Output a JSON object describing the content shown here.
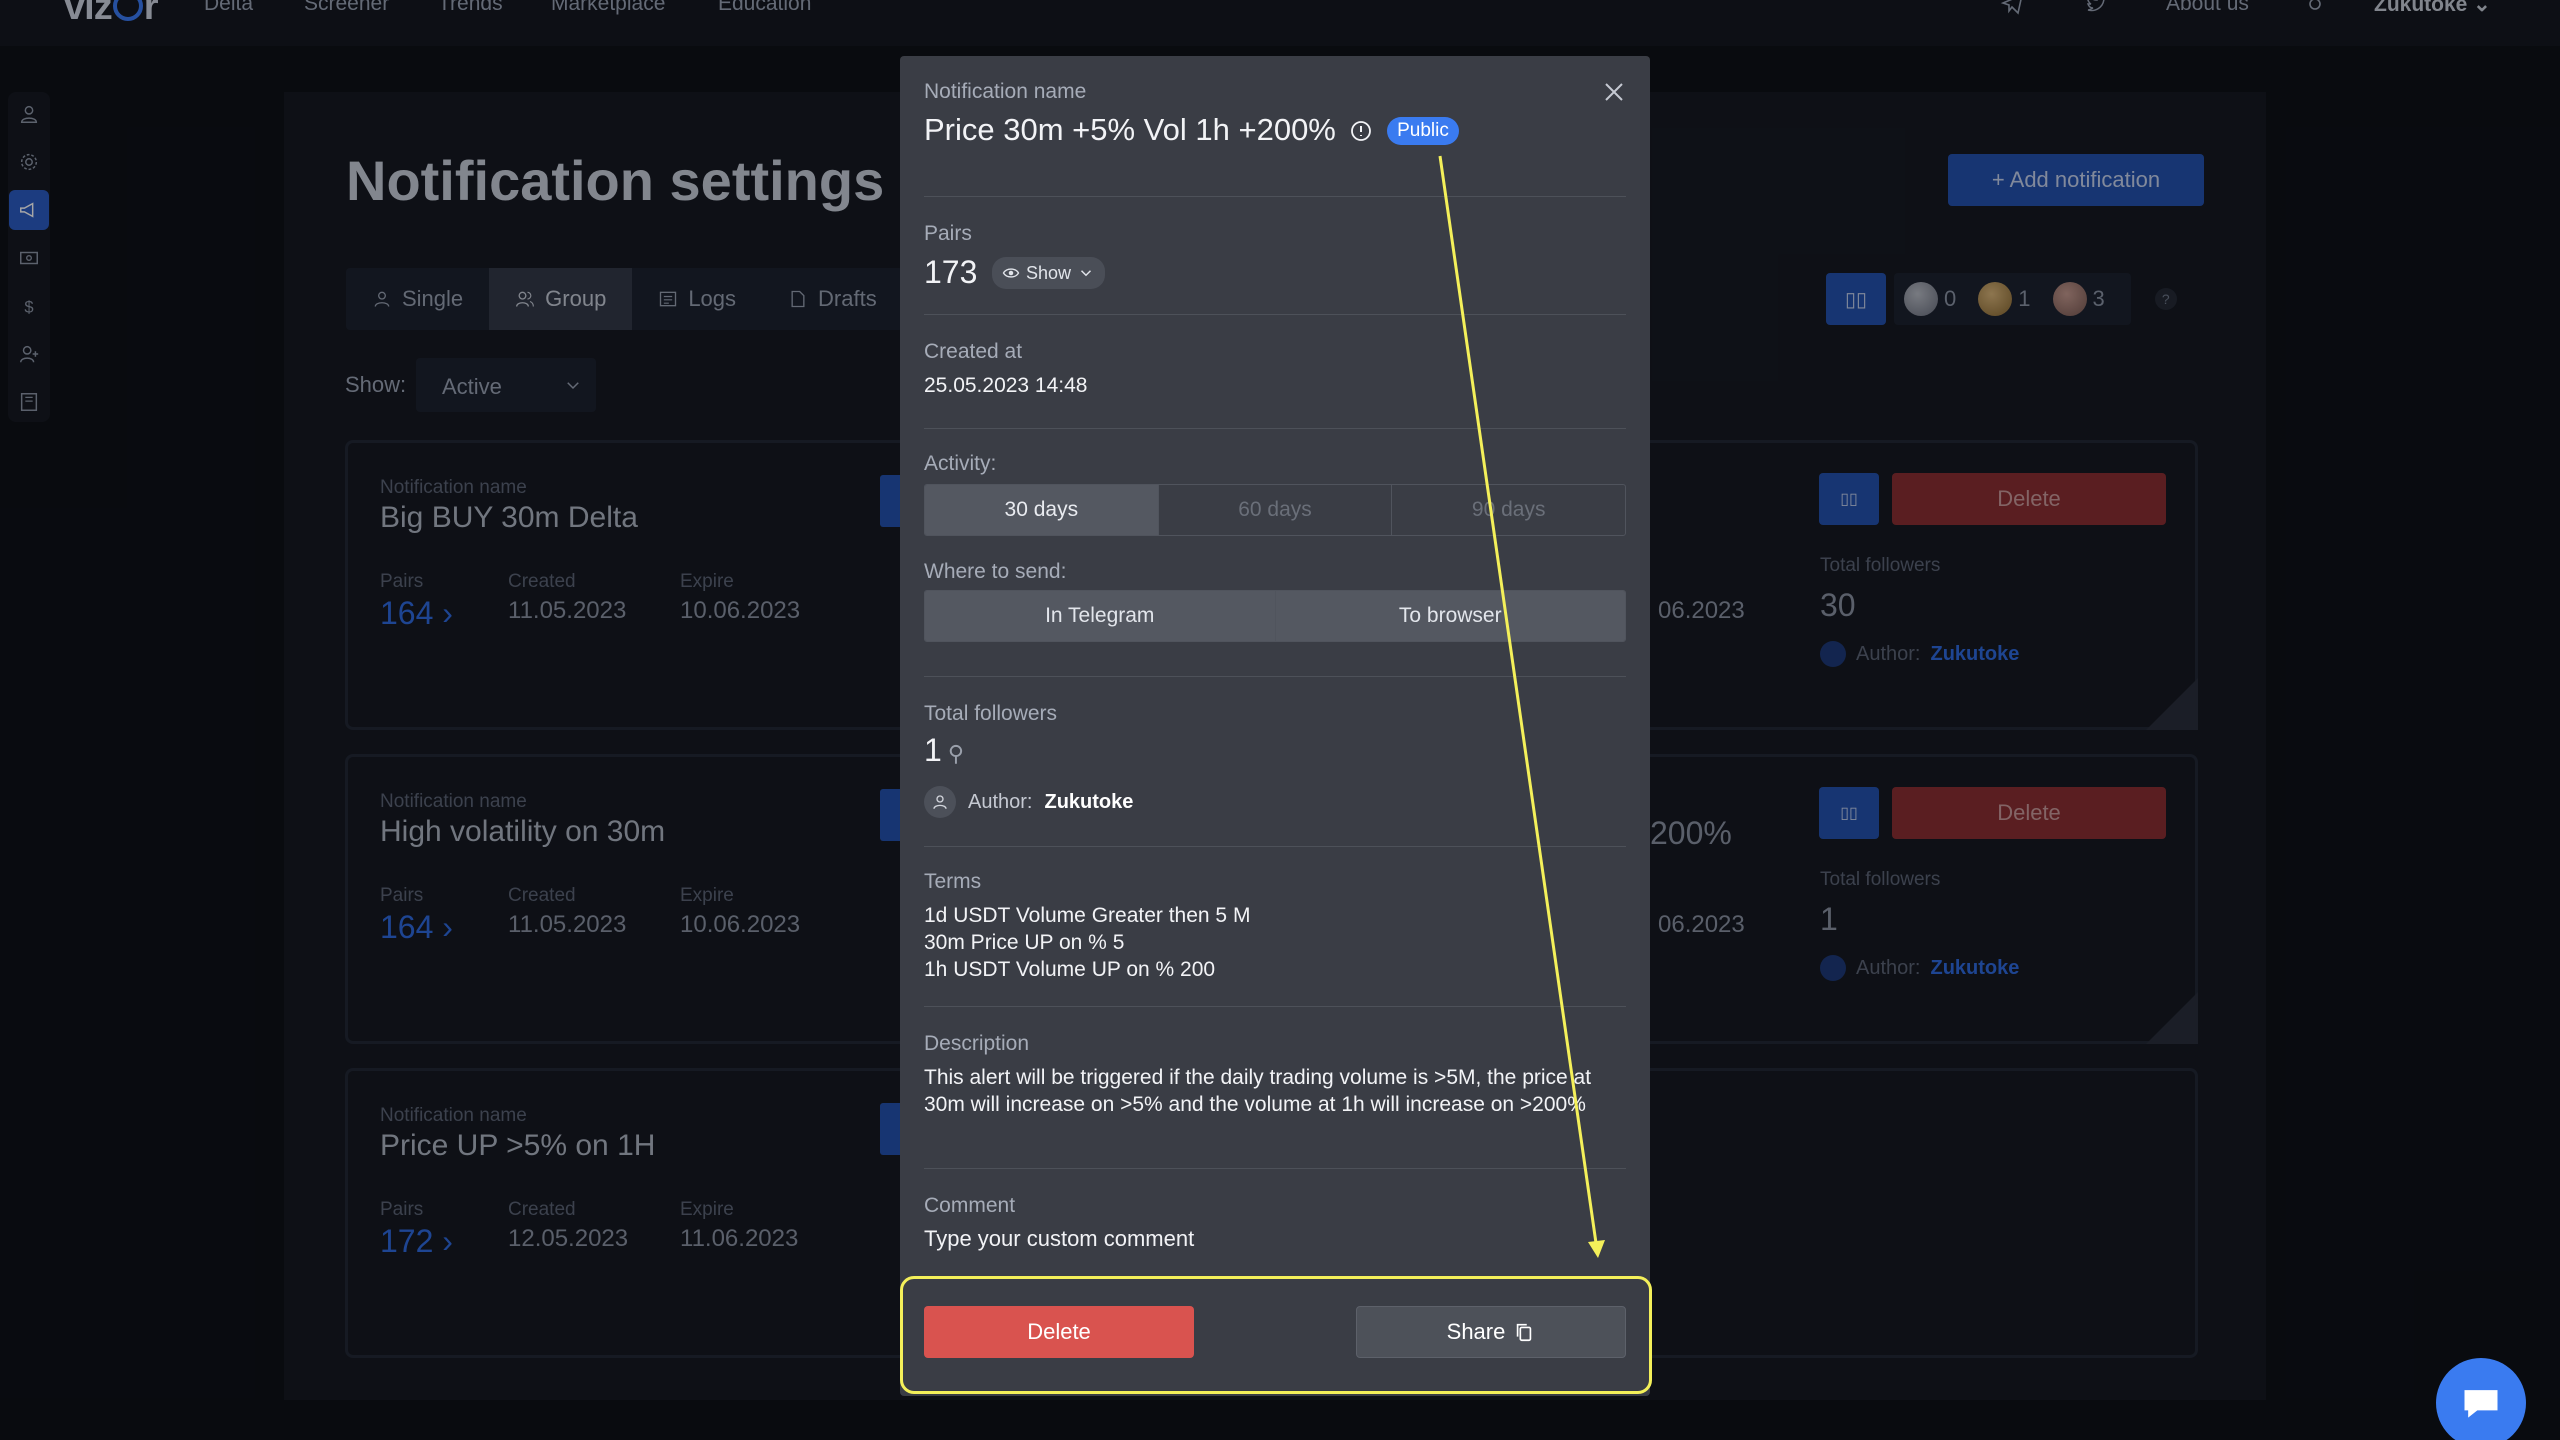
{
  "nav": {
    "logo": "vizor",
    "items": [
      "Delta",
      "Screener",
      "Trends",
      "Marketplace",
      "Education"
    ],
    "about": "About us",
    "user": "Zukutoke"
  },
  "page": {
    "title": "Notification settings",
    "add_button": "+ Add notification",
    "tabs": [
      "Single",
      "Group",
      "Logs",
      "Drafts"
    ],
    "show_label": "Show:",
    "show_value": "Active",
    "counters": [
      "0",
      "1",
      "3"
    ],
    "help": "?"
  },
  "cards": [
    {
      "label": "Notification name",
      "name": "Big BUY 30m Delta",
      "pairs_label": "Pairs",
      "pairs": "164",
      "created_label": "Created",
      "created": "11.05.2023",
      "expire_label": "Expire",
      "expire": "10.06.2023",
      "right_expire": "06.2023",
      "followers_label": "Total followers",
      "followers": "30",
      "author_label": "Author:",
      "author": "Zukutoke",
      "delete": "Delete"
    },
    {
      "label": "Notification name",
      "name": "High volatility on 30m",
      "pairs_label": "Pairs",
      "pairs": "164",
      "created_label": "Created",
      "created": "11.05.2023",
      "expire_label": "Expire",
      "expire": "10.06.2023",
      "right_name": "200%",
      "right_expire": "06.2023",
      "followers_label": "Total followers",
      "followers": "1",
      "author_label": "Author:",
      "author": "Zukutoke",
      "delete": "Delete"
    },
    {
      "label": "Notification name",
      "name": "Price UP >5% on 1H",
      "pairs_label": "Pairs",
      "pairs": "172",
      "created_label": "Created",
      "created": "12.05.2023",
      "expire_label": "Expire",
      "expire": "11.06.2023"
    }
  ],
  "modal": {
    "name_label": "Notification name",
    "name": "Price 30m +5% Vol 1h +200%",
    "badge": "Public",
    "pairs_label": "Pairs",
    "pairs": "173",
    "pairs_show": "Show",
    "created_label": "Created at",
    "created": "25.05.2023 14:48",
    "activity_label": "Activity:",
    "activity_options": [
      "30 days",
      "60 days",
      "90 days"
    ],
    "send_label": "Where to send:",
    "send_options": [
      "In Telegram",
      "To browser"
    ],
    "followers_label": "Total followers",
    "followers": "1",
    "author_label": "Author:",
    "author": "Zukutoke",
    "terms_label": "Terms",
    "terms": [
      "1d USDT Volume Greater then 5 M",
      "30m Price UP on % 5",
      "1h USDT Volume UP on % 200"
    ],
    "description_label": "Description",
    "description": "This alert will be triggered if the daily trading volume is >5M, the price at 30m will increase on >5% and the volume at 1h will increase on >200%",
    "comment_label": "Comment",
    "comment_placeholder": "Type your custom comment",
    "delete": "Delete",
    "share": "Share"
  },
  "colors": {
    "accent": "#3a7bf0",
    "danger": "#d9534f",
    "highlight": "#f4f05a"
  }
}
